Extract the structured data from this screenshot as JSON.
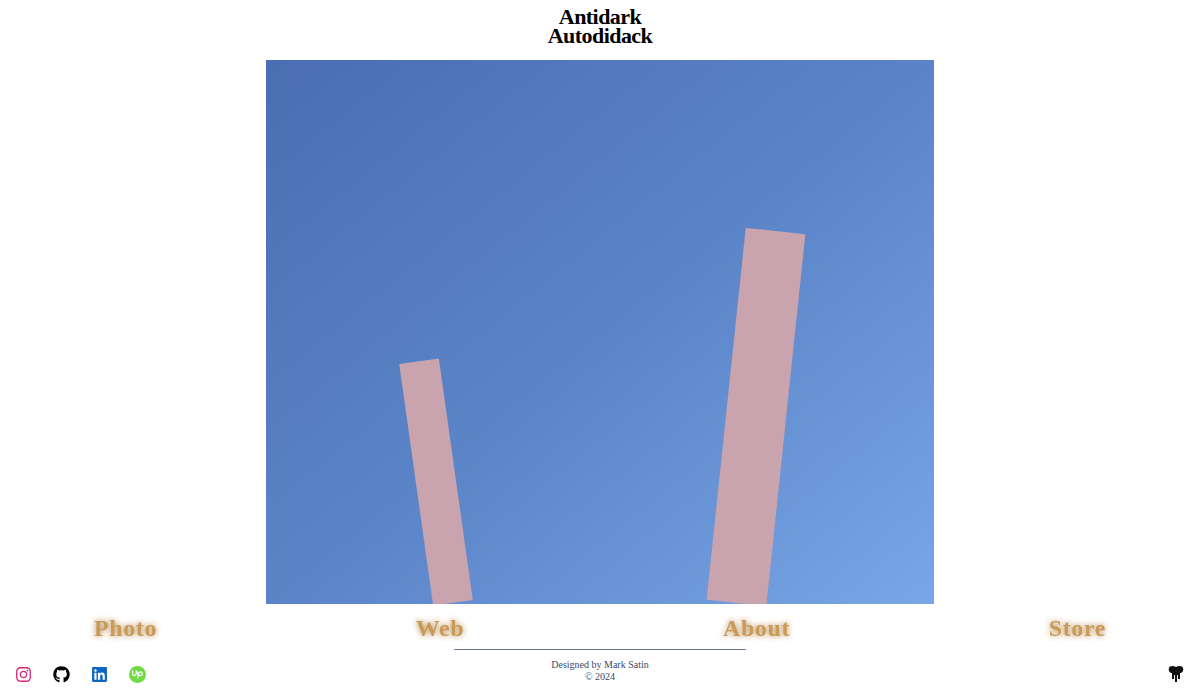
{
  "header": {
    "title_lines": [
      "Antidark",
      "Autodidack"
    ]
  },
  "nav": [
    {
      "label": "Photo"
    },
    {
      "label": "Web"
    },
    {
      "label": "About"
    },
    {
      "label": "Store"
    }
  ],
  "footer": {
    "credit": "Designed by Mark Satin",
    "copyright": "© 2024"
  }
}
